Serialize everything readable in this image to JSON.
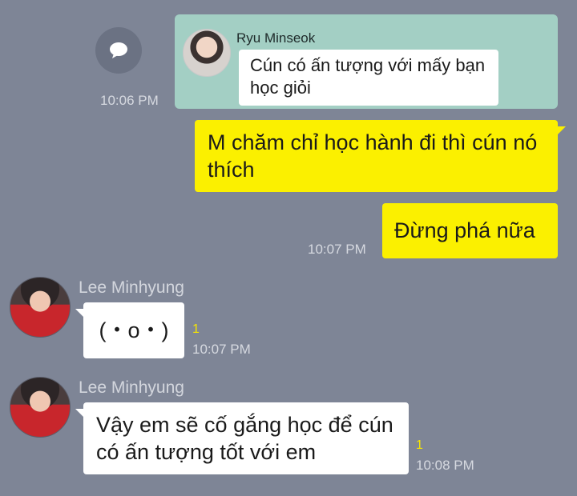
{
  "reply": {
    "name": "Ryu Minseok",
    "text": "Cún có ấn tượng với mấy bạn học giỏi",
    "time": "10:06 PM"
  },
  "outgoing": [
    {
      "text": "M chăm chỉ học hành đi thì cún nó thích"
    },
    {
      "text": "Đừng phá nữa",
      "time": "10:07 PM"
    }
  ],
  "incoming": [
    {
      "sender": "Lee Minhyung",
      "text": "(・o・)",
      "unread": "1",
      "time": "10:07 PM"
    },
    {
      "sender": "Lee Minhyung",
      "text": "Vậy em sẽ cố gắng học để cún có ấn tượng tốt với em",
      "unread": "1",
      "time": "10:08 PM"
    }
  ],
  "icons": {
    "share": "chat-bubble-icon"
  },
  "colors": {
    "background": "#7e8596",
    "reply_card": "#a3cfc4",
    "outgoing_bubble": "#fbf000",
    "incoming_bubble": "#ffffff",
    "unread_count": "#f6e500"
  }
}
